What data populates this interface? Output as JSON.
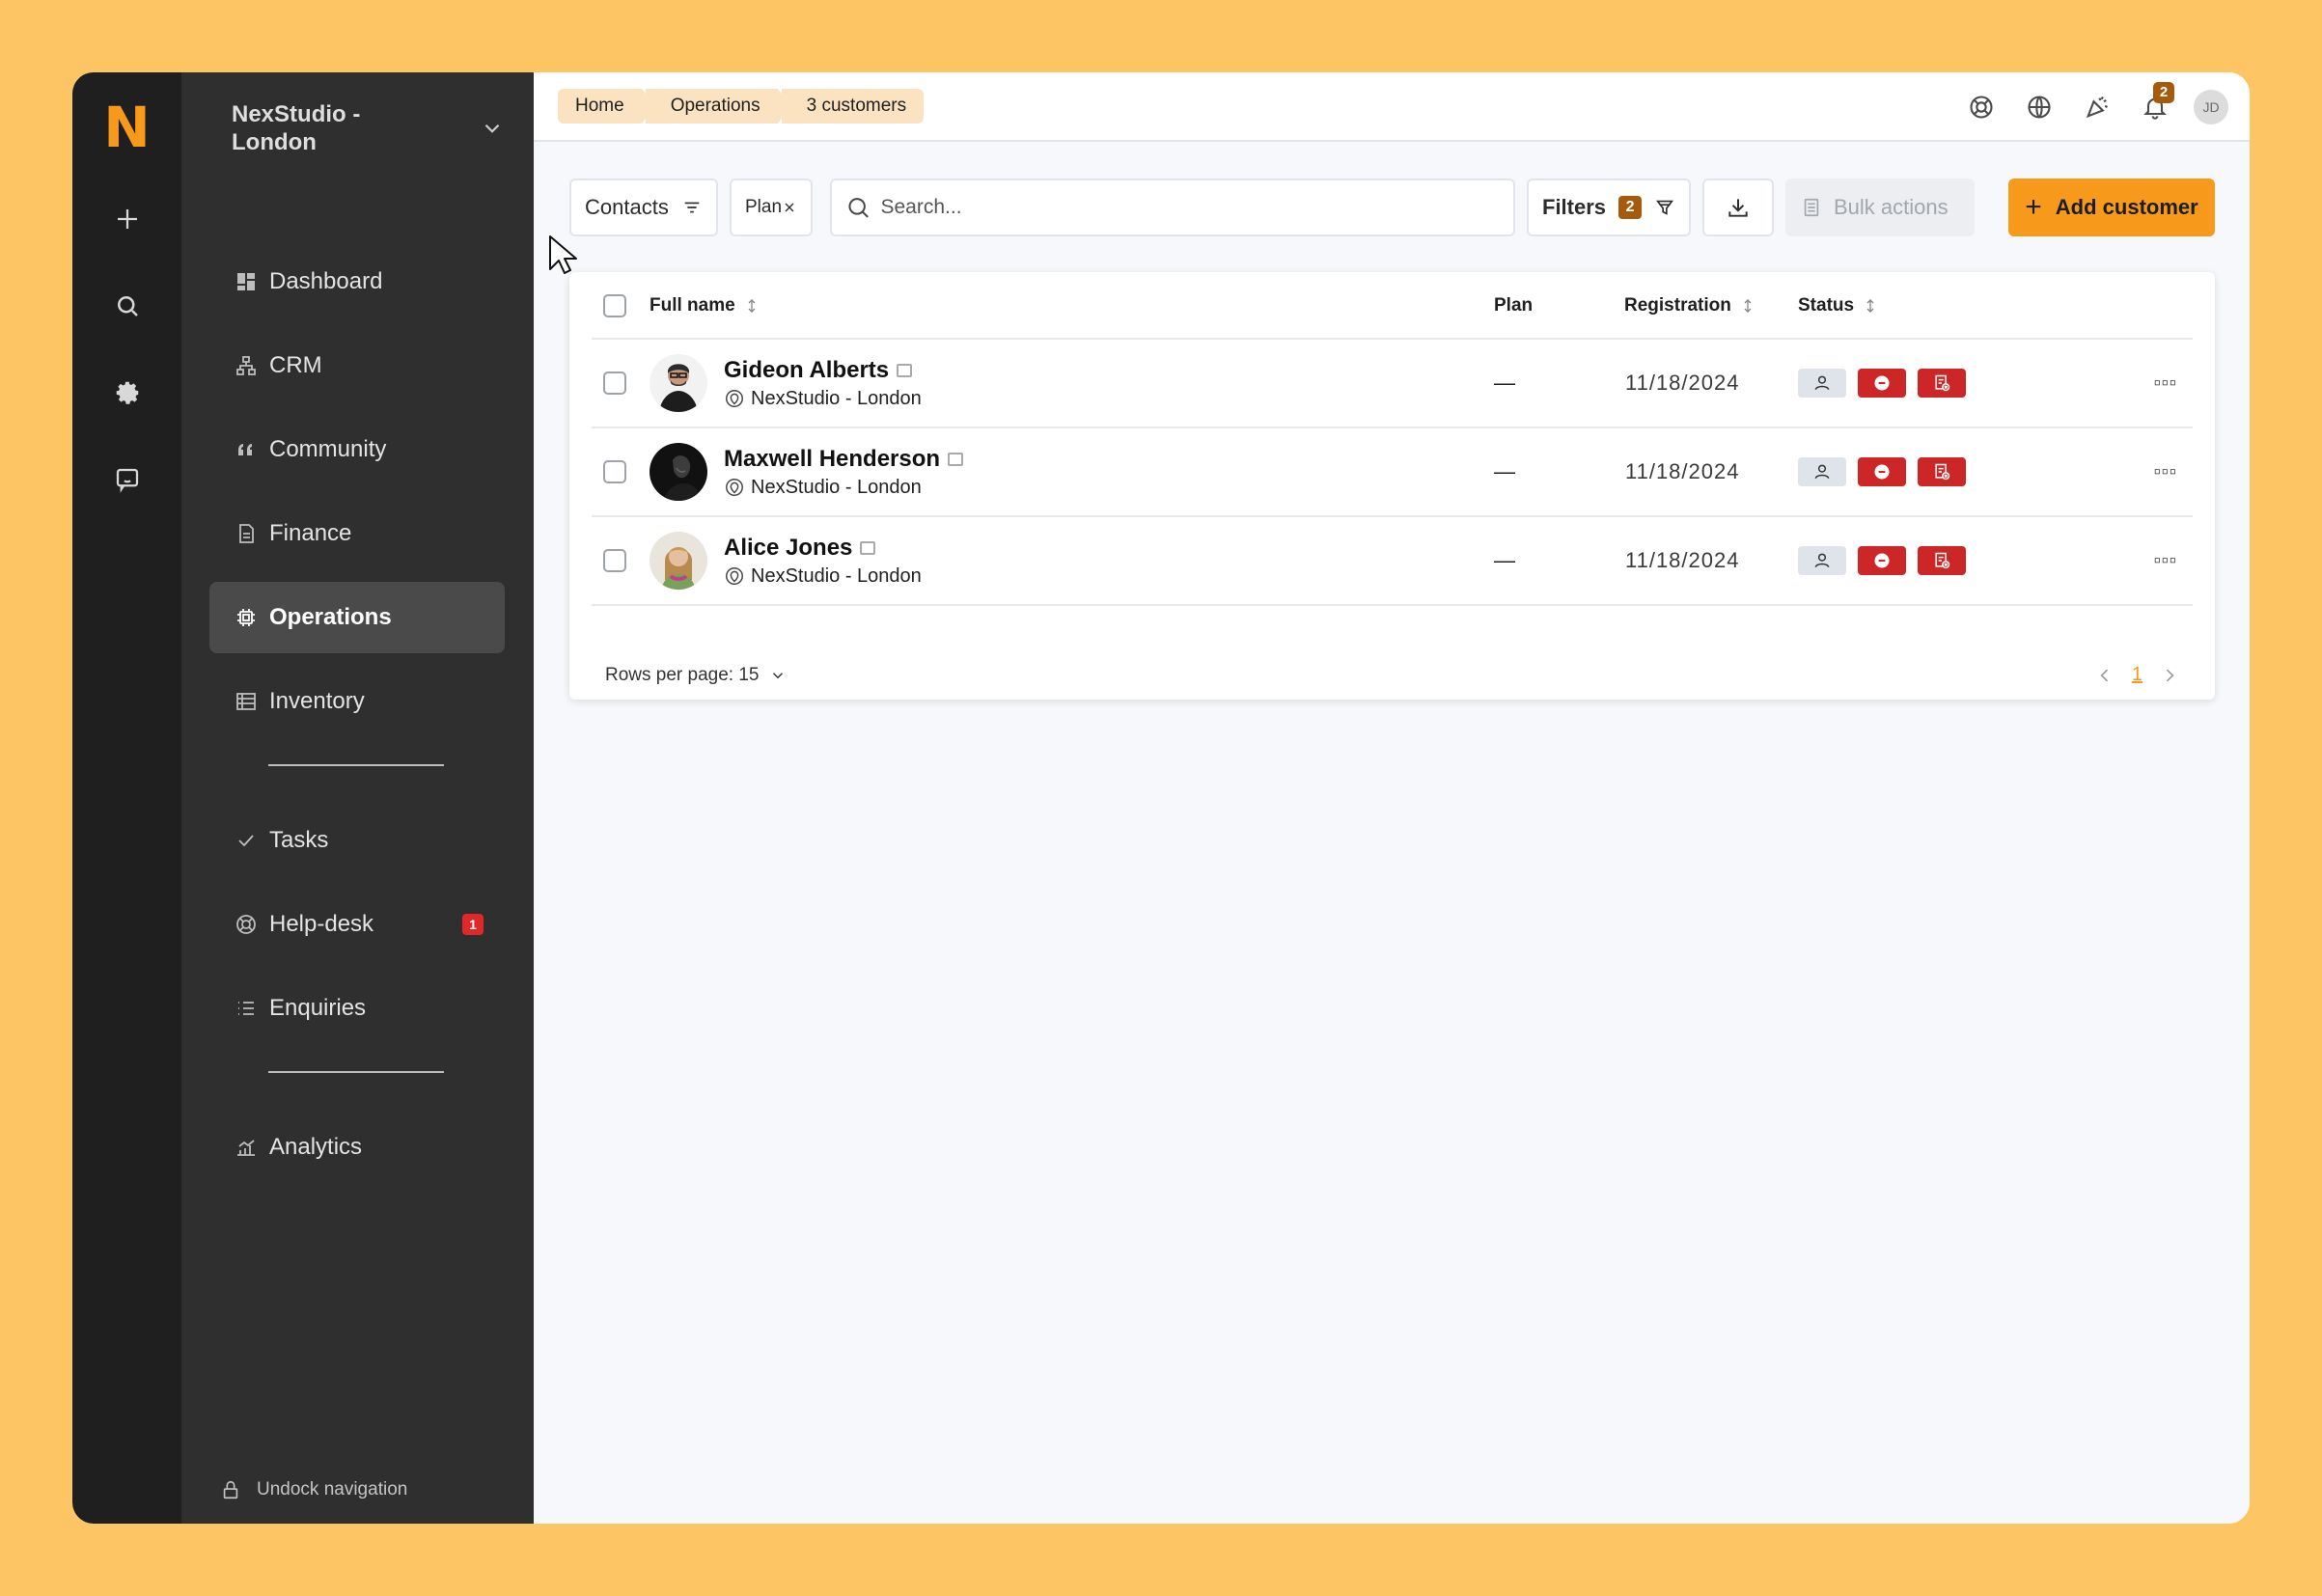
{
  "app": {
    "logo": "N",
    "workspace": "NexStudio - London",
    "accent": "#f79a1c"
  },
  "rail": [
    {
      "icon": "plus-icon"
    },
    {
      "icon": "search-icon"
    },
    {
      "icon": "gear-icon"
    },
    {
      "icon": "chat-icon"
    }
  ],
  "sidebar": {
    "items": [
      {
        "label": "Dashboard",
        "icon": "dashboard-icon"
      },
      {
        "label": "CRM",
        "icon": "sitemap-icon"
      },
      {
        "label": "Community",
        "icon": "quote-icon"
      },
      {
        "label": "Finance",
        "icon": "document-icon"
      },
      {
        "label": "Operations",
        "icon": "chip-icon",
        "active": true
      },
      {
        "label": "Inventory",
        "icon": "table-icon"
      },
      {
        "label": "Tasks",
        "icon": "check-icon"
      },
      {
        "label": "Help-desk",
        "icon": "lifebuoy-icon",
        "badge": "1"
      },
      {
        "label": "Enquiries",
        "icon": "list-icon"
      },
      {
        "label": "Analytics",
        "icon": "chart-icon"
      }
    ],
    "undock": "Undock navigation"
  },
  "breadcrumb": [
    "Home",
    "Operations",
    "3 customers"
  ],
  "topbar": {
    "notifications_count": "2",
    "user_initials": "JD"
  },
  "toolbar": {
    "contacts_label": "Contacts",
    "plan_chip": "Plan",
    "search_placeholder": "Search...",
    "filters_label": "Filters",
    "filters_count": "2",
    "bulk_label": "Bulk actions",
    "add_label": "Add customer"
  },
  "table": {
    "headers": {
      "name": "Full name",
      "plan": "Plan",
      "registration": "Registration",
      "status": "Status"
    },
    "rows": [
      {
        "name": "Gideon Alberts",
        "location": "NexStudio - London",
        "plan": "—",
        "registration": "11/18/2024"
      },
      {
        "name": "Maxwell Henderson",
        "location": "NexStudio - London",
        "plan": "—",
        "registration": "11/18/2024"
      },
      {
        "name": "Alice Jones",
        "location": "NexStudio - London",
        "plan": "—",
        "registration": "11/18/2024"
      }
    ],
    "rows_per_page": "Rows per page: 15",
    "page": "1"
  }
}
